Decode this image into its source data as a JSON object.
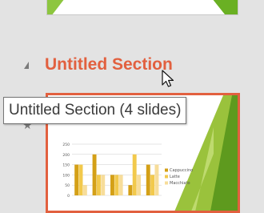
{
  "section": {
    "title": "Untitled Section"
  },
  "tooltip": {
    "text": "Untitled Section (4 slides)"
  },
  "chart_data": {
    "type": "bar",
    "categories": [
      "1",
      "2",
      "3",
      "4",
      "5"
    ],
    "series": [
      {
        "name": "Cappuccino",
        "values": [
          150,
          200,
          100,
          50,
          150
        ]
      },
      {
        "name": "Latte",
        "values": [
          150,
          100,
          100,
          200,
          100
        ]
      },
      {
        "name": "Macchiato",
        "values": [
          50,
          100,
          100,
          100,
          150
        ]
      }
    ],
    "yticks": [
      "250",
      "200",
      "150",
      "100",
      "50",
      "0"
    ],
    "ylim": [
      0,
      250
    ],
    "colors": [
      "#d4a017",
      "#f2c94c",
      "#f7dd9a"
    ],
    "legend": "right"
  },
  "icons": {
    "collapse": "collapse-arrow-icon",
    "cursor": "mouse-pointer-icon",
    "star": "star-icon"
  }
}
